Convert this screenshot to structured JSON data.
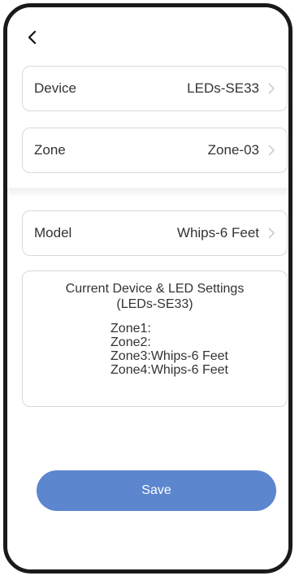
{
  "nav": {
    "back_icon": "chevron-left-icon"
  },
  "device_row": {
    "label": "Device",
    "value": "LEDs-SE33"
  },
  "zone_row": {
    "label": "Zone",
    "value": "Zone-03"
  },
  "model_row": {
    "label": "Model",
    "value": "Whips-6 Feet"
  },
  "settings": {
    "title_line1": "Current Device & LED Settings",
    "title_line2": "(LEDs-SE33)",
    "zones": [
      "Zone1:",
      "Zone2:",
      "Zone3:Whips-6 Feet",
      "Zone4:Whips-6 Feet"
    ]
  },
  "save_label": "Save",
  "colors": {
    "accent": "#5c86ce",
    "border": "#d9d9d9",
    "text": "#333333"
  }
}
